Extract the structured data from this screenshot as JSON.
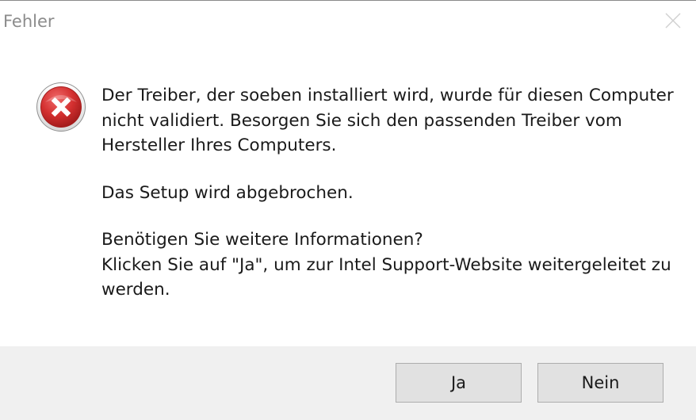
{
  "window": {
    "title": "Fehler"
  },
  "icons": {
    "close": "close-icon",
    "error": "error-icon"
  },
  "message": {
    "paragraph1": [
      "Der Treiber, der soeben installiert wird, wurde für diesen Computer",
      "nicht validiert. Besorgen Sie sich den passenden Treiber vom",
      "Hersteller Ihres Computers."
    ],
    "paragraph2": [
      "Das Setup wird abgebrochen."
    ],
    "paragraph3": [
      "Benötigen Sie weitere Informationen?",
      "Klicken Sie auf \"Ja\", um zur Intel Support-Website weitergeleitet zu",
      "werden."
    ]
  },
  "buttons": {
    "yes_label": "Ja",
    "no_label": "Nein"
  },
  "colors": {
    "error_red": "#c8262a",
    "footer_bg": "#f0f0f0",
    "button_bg": "#e1e1e1"
  }
}
